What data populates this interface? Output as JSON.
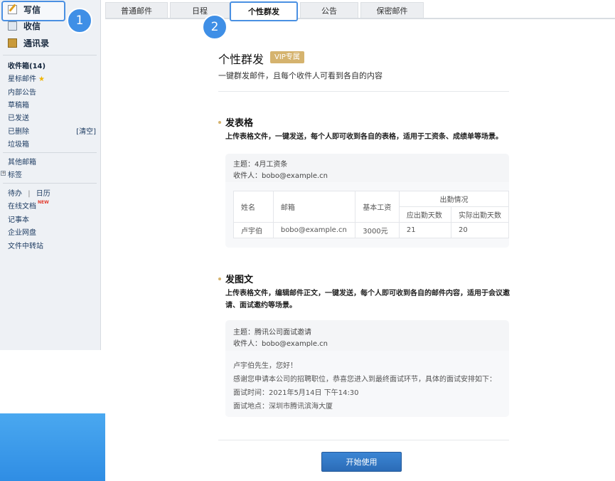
{
  "sidebar": {
    "compose_label": "写信",
    "inbox_label": "收信",
    "contacts_label": "通讯录",
    "folders": [
      {
        "label": "收件箱(14)"
      },
      {
        "label": "星标邮件"
      },
      {
        "label": "内部公告"
      },
      {
        "label": "草稿箱"
      },
      {
        "label": "已发送"
      },
      {
        "label": "已删除"
      },
      {
        "label": "垃圾箱"
      }
    ],
    "clear_label": "[清空]",
    "other_mail": "其他邮箱",
    "tags": "标签",
    "todo": "待办",
    "separator": "|",
    "calendar": "日历",
    "online_docs": "在线文档",
    "new_badge": "NEW",
    "notes": "记事本",
    "netdisk": "企业网盘",
    "file_transfer": "文件中转站"
  },
  "callouts": [
    "1",
    "2"
  ],
  "tabs": [
    {
      "label": "普通邮件"
    },
    {
      "label": "日程"
    },
    {
      "label": "个性群发"
    },
    {
      "label": "公告"
    },
    {
      "label": "保密邮件"
    }
  ],
  "main": {
    "title": "个性群发",
    "vip_badge": "VIP专属",
    "subtitle": "一键群发邮件，且每个收件人可看到各自的内容",
    "section1": {
      "heading": "发表格",
      "desc": "上传表格文件，一键发送，每个人即可收到各自的表格，适用于工资条、成绩单等场景。",
      "subject": "主题：4月工资条",
      "recipient": "收件人：bobo@example.cn",
      "table": {
        "headers": [
          "姓名",
          "邮箱",
          "基本工资",
          "出勤情况"
        ],
        "subheaders": [
          "应出勤天数",
          "实际出勤天数"
        ],
        "row": [
          "卢宇伯",
          "bobo@example.cn",
          "3000元",
          "21",
          "20"
        ]
      }
    },
    "section2": {
      "heading": "发图文",
      "desc": "上传表格文件，编辑邮件正文，一键发送，每个人即可收到各自的邮件内容，适用于会议邀请、面试邀约等场景。",
      "subject": "主题：腾讯公司面试邀请",
      "recipient": "收件人：bobo@example.cn",
      "lines": [
        "卢宇伯先生，您好！",
        "感谢您申请本公司的招聘职位，恭喜您进入到最终面试环节，具体的面试安排如下：",
        "面试时间：2021年5月14日 下午14:30",
        "面试地点：深圳市腾讯滨海大厦"
      ]
    },
    "start_button": "开始使用"
  }
}
